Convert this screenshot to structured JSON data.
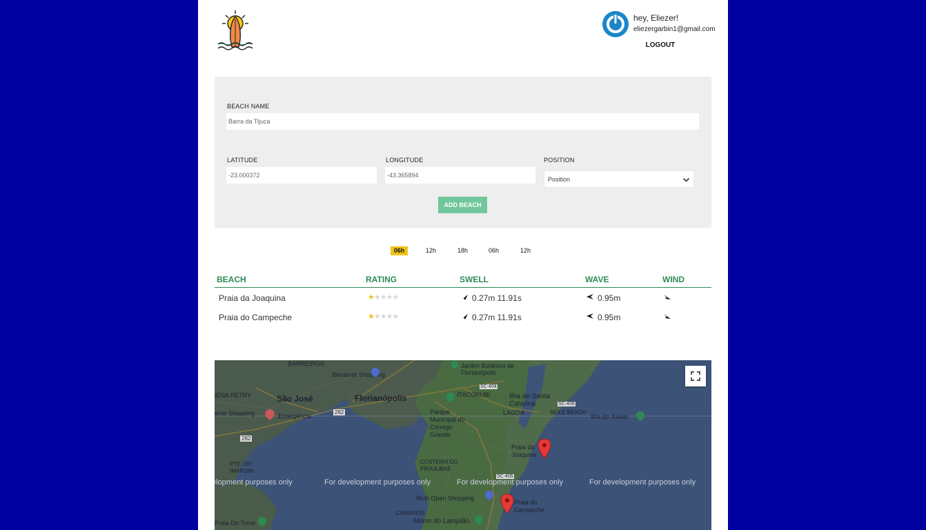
{
  "user": {
    "greeting": "hey, Eliezer!",
    "email": "eliezergarbin1@gmail.com",
    "logout_label": "LOGOUT"
  },
  "form": {
    "beach_name_label": "BEACH NAME",
    "beach_name_value": "Barra da Tijuca",
    "latitude_label": "LATITUDE",
    "latitude_value": "-23.000372",
    "longitude_label": "LONGITUDE",
    "longitude_value": "-43.365894",
    "position_label": "POSITION",
    "position_selected": "Position",
    "submit_label": "ADD BEACH"
  },
  "time_tabs": [
    {
      "label": "06h",
      "active": true
    },
    {
      "label": "12h",
      "active": false
    },
    {
      "label": "18h",
      "active": false
    },
    {
      "label": "06h",
      "active": false
    },
    {
      "label": "12h",
      "active": false
    }
  ],
  "table": {
    "headers": [
      "BEACH",
      "RATING",
      "SWELL",
      "WAVE",
      "WIND"
    ],
    "rows": [
      {
        "beach": "Praia da Joaquina",
        "rating": 1,
        "rating_max": 5,
        "swell": "0.27m 11.91s",
        "wave": "0.95m"
      },
      {
        "beach": "Praia do Campeche",
        "rating": 1,
        "rating_max": 5,
        "swell": "0.27m 11.91s",
        "wave": "0.95m"
      }
    ]
  },
  "map": {
    "labels": {
      "barreiros": "BARREIROS",
      "beiramar": "Beiramar Shopping",
      "jardim": "Jardim Botânico de Florianópolis",
      "sao_jose": "São José",
      "florianopolis": "Florianópolis",
      "itacorubi": "ITACORUBI",
      "ilha": "Ilha de Santa Catarina",
      "petry": "IENA PETRY",
      "shopping": "ente Shopping",
      "emergencia": "Emergência",
      "parque": "Parque Municipal do Córrego Grande",
      "lagoa": "LAGOA",
      "mole": "MOLE BEACH",
      "xavier": "Ilha do Xavier",
      "joaquina": "Praia da Joaquina",
      "costeira": "COSTEIRA DO PIRAJUBAÉ",
      "imaruim": "PTE. DO IMARUIM",
      "campeche": "Praia do Campeche",
      "multi": "Multi Open Shopping",
      "carianos": "CARIANOS",
      "morro": "Morro do Lampião",
      "tome": "Praia Do Tome",
      "r282a": "282",
      "r282b": "282",
      "sc404": "SC-404",
      "sc406": "SC-406",
      "sc405": "SC-405"
    },
    "dev_notice": [
      "elopment purposes only",
      "For development purposes only",
      "For development purposes only",
      "For development purposes only"
    ],
    "pin_color": "#e53935"
  },
  "colors": {
    "background": "#0101a0",
    "accent_green": "#2e8b57",
    "button_green": "#72c69c",
    "active_tab": "#f0c419",
    "avatar": "#1a86c8"
  }
}
